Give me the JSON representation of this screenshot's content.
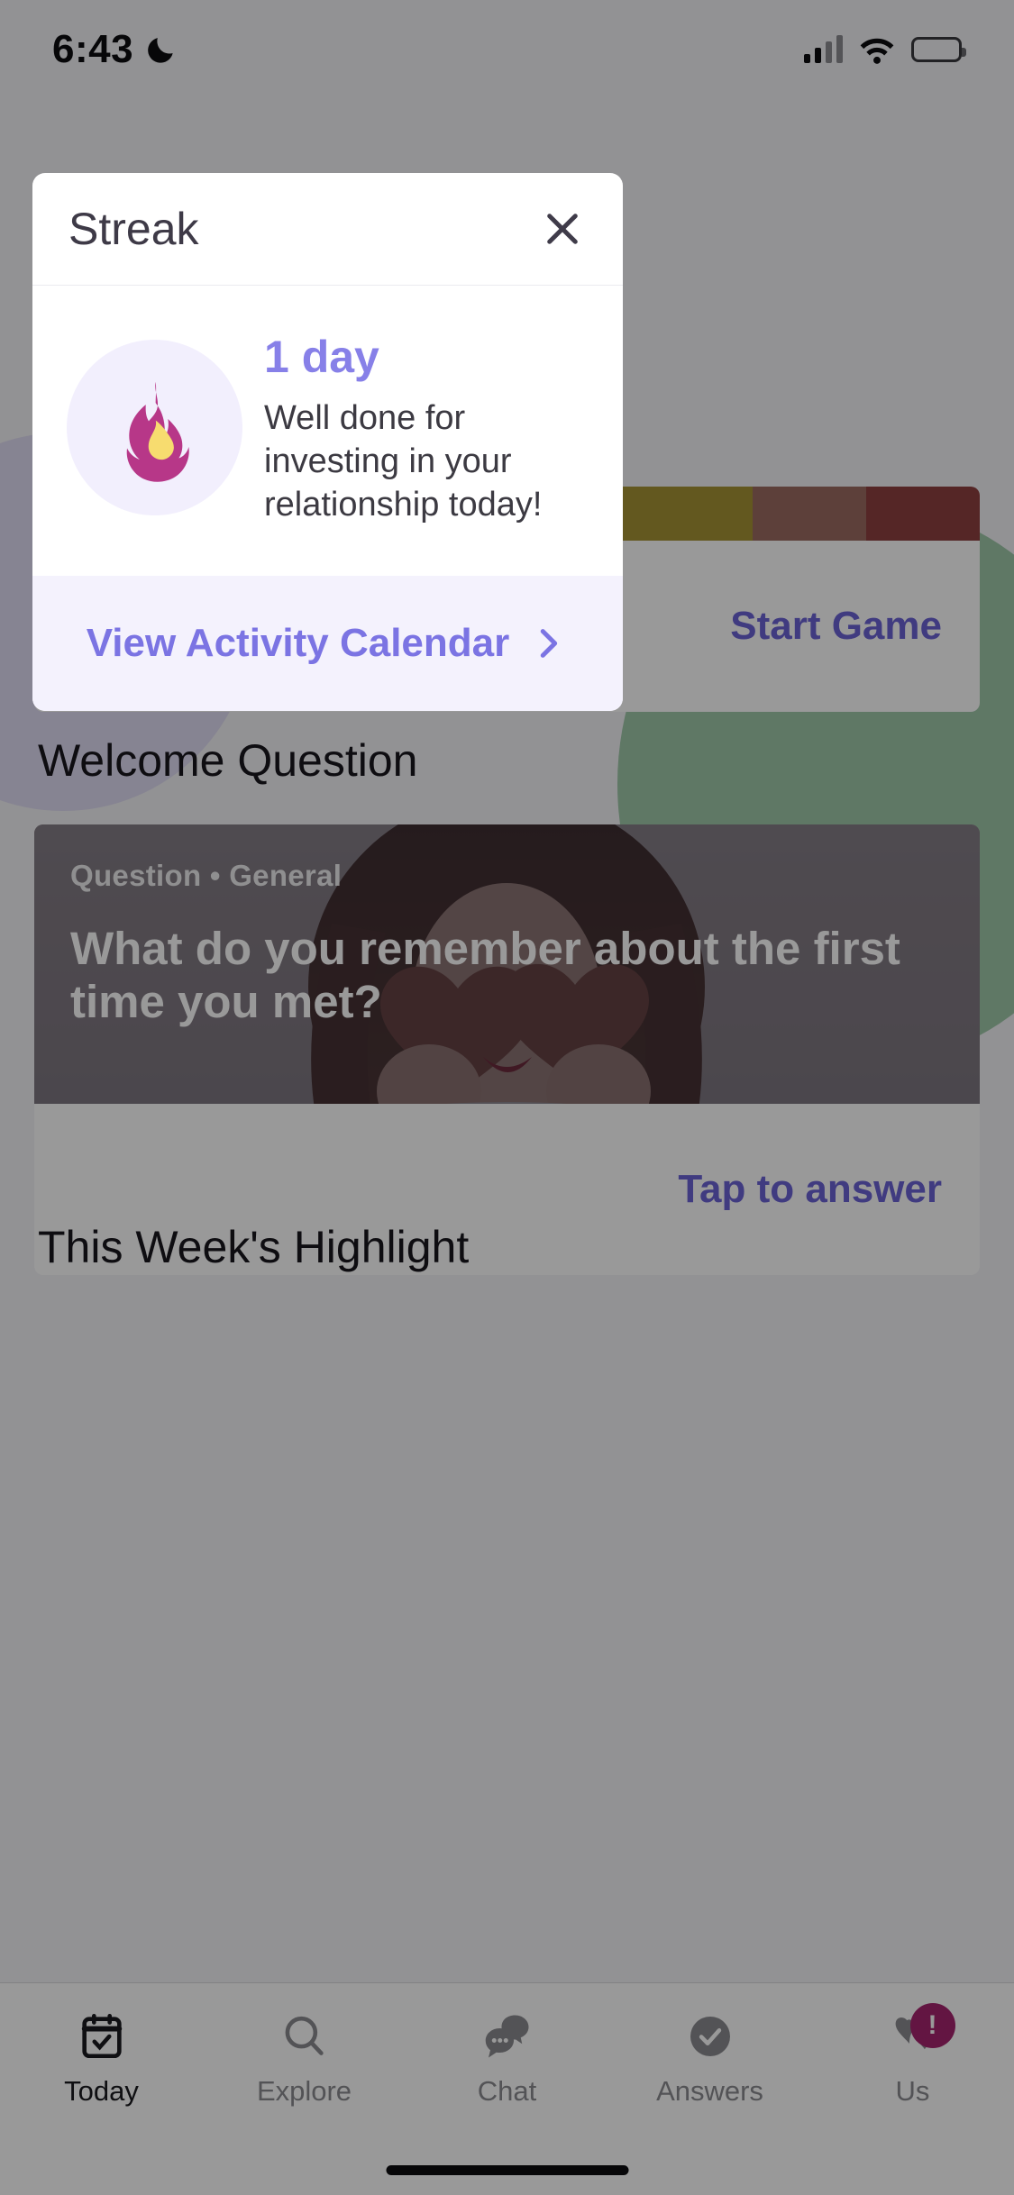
{
  "status_bar": {
    "time": "6:43",
    "dnd_icon": "crescent-moon-icon",
    "signal_icon": "cellular-signal-icon",
    "wifi_icon": "wifi-icon",
    "battery_icon": "battery-full-icon"
  },
  "modal": {
    "title": "Streak",
    "close_icon": "close-x-icon",
    "flame_icon": "flame-icon",
    "count": "1 day",
    "description": "Well done for investing in your relationship today!",
    "footer_label": "View Activity Calendar",
    "footer_chevron_icon": "chevron-right-icon",
    "accent_color": "#7b74e3",
    "count_color": "#8780e8",
    "footer_bg_color": "#f4f2fd",
    "flame_outer_color": "#b73788",
    "flame_inner_color": "#f7dc6f",
    "flame_bg_color": "#f2effd"
  },
  "background_screen": {
    "game_card": {
      "action_label": "Start Game",
      "stripes": [
        {
          "color": "#4f6e70",
          "width": "40%"
        },
        {
          "color": "#87a28b",
          "width": "20%"
        },
        {
          "color": "#a59335",
          "width": "16%"
        },
        {
          "color": "#9b6b62",
          "width": "12%"
        },
        {
          "color": "#8e4040",
          "width": "12%"
        }
      ]
    },
    "welcome_section_title": "Welcome Question",
    "question_card": {
      "kicker": "Question • General",
      "title": "What do you remember about the first time you met?",
      "action_label": "Tap to answer"
    },
    "next_section_title": "This Week's Highlight"
  },
  "tab_bar": {
    "tabs": [
      {
        "label": "Today",
        "icon": "calendar-check-icon",
        "active": true,
        "badge": ""
      },
      {
        "label": "Explore",
        "icon": "search-icon",
        "active": false,
        "badge": ""
      },
      {
        "label": "Chat",
        "icon": "chat-bubbles-icon",
        "active": false,
        "badge": ""
      },
      {
        "label": "Answers",
        "icon": "check-circle-icon",
        "active": false,
        "badge": ""
      },
      {
        "label": "Us",
        "icon": "hearts-icon",
        "active": false,
        "badge": "!"
      }
    ],
    "badge_color": "#a5246e"
  }
}
